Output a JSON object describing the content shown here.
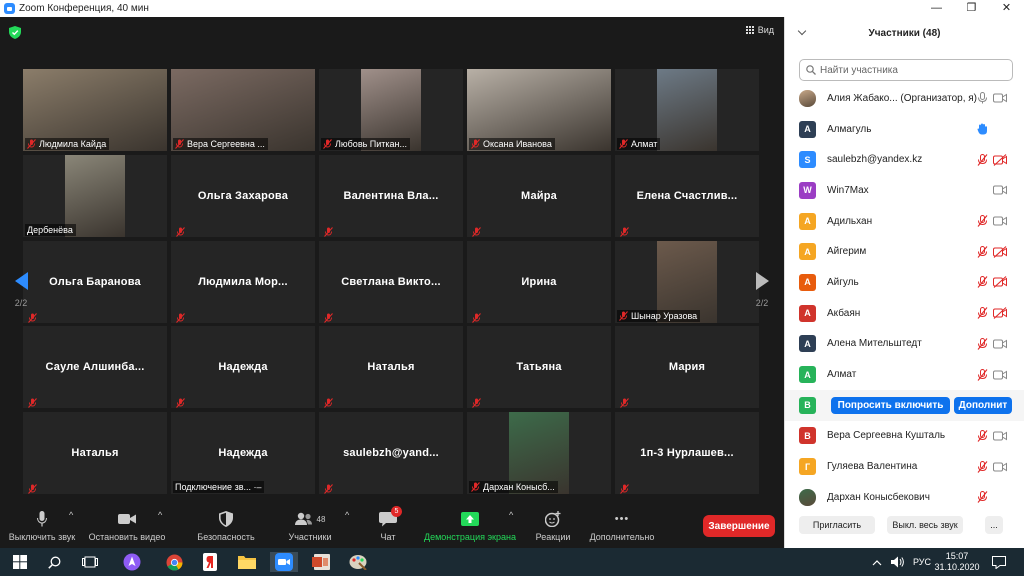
{
  "window": {
    "title": "Zoom Конференция, 40 мин",
    "minimize_icon": "—",
    "maximize_icon": "❐",
    "close_icon": "✕"
  },
  "video": {
    "view_label": "Вид",
    "page_left": "2/2",
    "page_right": "2/2",
    "tiles": [
      {
        "name": "Людмила Кайда",
        "video": true,
        "photo_color": "#8b7d6a"
      },
      {
        "name": "Вера Сергеевна ...",
        "video": true,
        "photo_color": "#7b6a62"
      },
      {
        "name": "Любовь Питкан...",
        "video": true,
        "photo_color": "#a0908a"
      },
      {
        "name": "Оксана Иванова",
        "video": true,
        "photo_color": "#b8b0a6"
      },
      {
        "name": "Алмат",
        "video": true,
        "photo_color": "#6d7a86"
      },
      {
        "name": "Дербенёва",
        "video": true,
        "photo_color": "#8a8678"
      },
      {
        "name": "Ольга Захарова",
        "video": false
      },
      {
        "name": "Валентина Вла...",
        "video": false
      },
      {
        "name": "Майра",
        "video": false
      },
      {
        "name": "Елена Счастлив...",
        "video": false
      },
      {
        "name": "Ольга Баранова",
        "video": false
      },
      {
        "name": "Людмила Мор...",
        "video": false
      },
      {
        "name": "Светлана Викто...",
        "video": false
      },
      {
        "name": "Ирина",
        "video": false
      },
      {
        "name": "Шынар Уразова",
        "video": true,
        "photo_color": "#6c5a4c"
      },
      {
        "name": "Сауле Алшинба...",
        "video": false
      },
      {
        "name": "Надежда",
        "video": false
      },
      {
        "name": "Наталья",
        "video": false
      },
      {
        "name": "Татьяна",
        "video": false
      },
      {
        "name": "Мария",
        "video": false
      },
      {
        "name": "Наталья",
        "video": false
      },
      {
        "name": "Надежда",
        "video": false,
        "status": "Подключение зв... ·–"
      },
      {
        "name": "saulebzh@yand...",
        "video": false
      },
      {
        "name": "Дархан Конысб...",
        "video": true,
        "photo_color": "#3d6b4a"
      },
      {
        "name": "1п-3 Нурлашев...",
        "video": false
      }
    ]
  },
  "toolbar": {
    "mute": "Выключить звук",
    "stop_video": "Остановить видео",
    "security": "Безопасность",
    "participants": "Участники",
    "participants_count": "48",
    "chat": "Чат",
    "chat_badge": "5",
    "share": "Демонстрация экрана",
    "reactions": "Реакции",
    "more": "Дополнительно",
    "end": "Завершение",
    "caret": "^",
    "more_icon": "•••"
  },
  "panel": {
    "title": "Участники (48)",
    "search_placeholder": "Найти участника",
    "participants": [
      {
        "initial": "",
        "name": "Алия Жабако... (Организатор, я)",
        "color": "#c8a98a",
        "photo": true,
        "mic": "on",
        "cam": "on"
      },
      {
        "initial": "А",
        "name": "Алмагуль",
        "color": "#2e3f55",
        "mic": "",
        "cam": "",
        "hand": true
      },
      {
        "initial": "S",
        "name": "saulebzh@yandex.kz",
        "color": "#2d8cff",
        "mic": "off",
        "cam": "off"
      },
      {
        "initial": "W",
        "name": "Win7Max",
        "color": "#9b3dc4",
        "mic": "",
        "cam": "on"
      },
      {
        "initial": "А",
        "name": "Адильхан",
        "color": "#f5a623",
        "mic": "off",
        "cam": "on"
      },
      {
        "initial": "А",
        "name": "Айгерим",
        "color": "#f5a623",
        "mic": "off",
        "cam": "off"
      },
      {
        "initial": "А",
        "name": "Айгуль",
        "color": "#e85c0d",
        "mic": "off",
        "cam": "off"
      },
      {
        "initial": "А",
        "name": "Акбаян",
        "color": "#d0342c",
        "mic": "off",
        "cam": "off"
      },
      {
        "initial": "А",
        "name": "Алена Мительштедт",
        "color": "#2e3f55",
        "mic": "off",
        "cam": "on"
      },
      {
        "initial": "А",
        "name": "Алмат",
        "color": "#27b35a",
        "mic": "off",
        "cam": "on"
      },
      {
        "initial": "В",
        "name": "",
        "color": "#27b35a",
        "mic": "",
        "cam": "",
        "buttons": [
          "Попросить включить",
          "Дополнит"
        ]
      },
      {
        "initial": "В",
        "name": "Вера Сергеевна Кушталь",
        "color": "#d0342c",
        "mic": "off",
        "cam": "on"
      },
      {
        "initial": "Г",
        "name": "Гуляева Валентина",
        "color": "#f5a623",
        "mic": "off",
        "cam": "on"
      },
      {
        "initial": "",
        "name": "Дархан Конысбекович",
        "color": "#3d6b4a",
        "photo": true,
        "mic": "off",
        "cam": ""
      }
    ],
    "invite": "Пригласить",
    "mute_all": "Выкл. весь звук",
    "more": "..."
  },
  "taskbar": {
    "lang": "РУС",
    "time": "15:07",
    "date": "31.10.2020"
  },
  "colors": {
    "accent": "#0e72ed",
    "end": "#e02828",
    "share": "#23d959",
    "muted": "#e02828"
  }
}
